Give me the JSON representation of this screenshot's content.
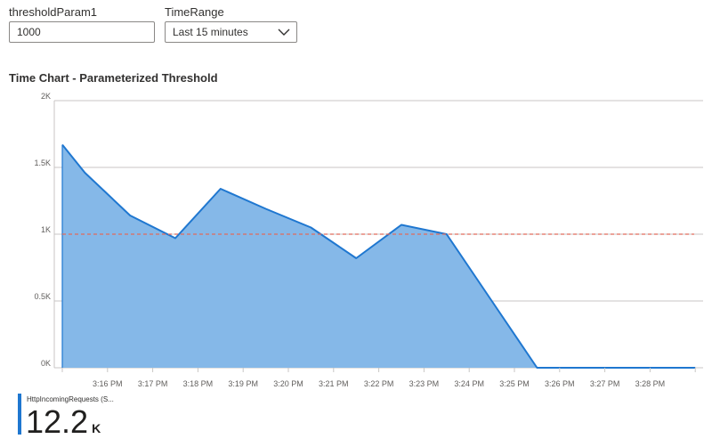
{
  "params": {
    "threshold": {
      "label": "thresholdParam1",
      "value": "1000"
    },
    "time_range": {
      "label": "TimeRange",
      "value": "Last 15 minutes"
    }
  },
  "chart_title": "Time Chart - Parameterized Threshold",
  "colors": {
    "area_fill": "#85b8e8",
    "area_line": "#1f77d0",
    "threshold_line": "#e06a5c",
    "gridline": "#c8c6c4"
  },
  "chart_data": {
    "type": "area",
    "title": "Time Chart - Parameterized Threshold",
    "xlabel": "",
    "ylabel": "",
    "y_ticks": [
      "0K",
      "0.5K",
      "1K",
      "1.5K",
      "2K"
    ],
    "ylim": [
      0,
      2000
    ],
    "x_ticks": [
      "3:16 PM",
      "3:17 PM",
      "3:18 PM",
      "3:19 PM",
      "3:20 PM",
      "3:21 PM",
      "3:22 PM",
      "3:23 PM",
      "3:24 PM",
      "3:25 PM",
      "3:26 PM",
      "3:27 PM",
      "3:28 PM"
    ],
    "x": [
      0,
      0.5,
      1.5,
      2.5,
      3.5,
      4.5,
      5.5,
      6.5,
      7.5,
      8.5,
      9.5,
      10.5,
      11.5,
      12.5,
      13.5,
      14
    ],
    "series": [
      {
        "name": "HttpIncomingRequests (S...",
        "values": [
          1670,
          1460,
          1140,
          970,
          1340,
          1190,
          1050,
          820,
          1070,
          1000,
          500,
          0,
          0,
          0,
          0,
          0
        ]
      }
    ],
    "threshold": 1000,
    "grid": true
  },
  "legend": {
    "series_name": "HttpIncomingRequests (S...",
    "value": "12.2",
    "unit": "K"
  }
}
